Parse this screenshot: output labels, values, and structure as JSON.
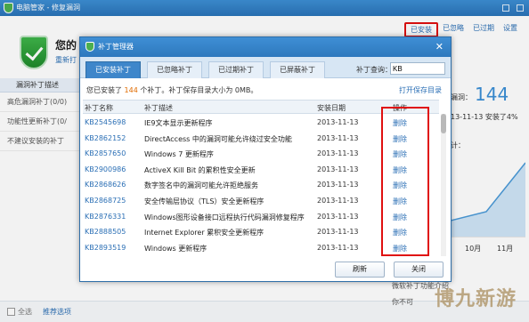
{
  "main_window": {
    "title": "电脑管家 - 修复漏洞",
    "status_title": "您的",
    "status_sub": "重新打",
    "top_links": [
      "已安装",
      "已忽略",
      "已过期",
      "设置"
    ],
    "side_tab": "漏洞补丁描述",
    "side_items": [
      "高危漏洞补丁(0/0)",
      "功能性更新补丁(0/",
      "不建议安装的补丁"
    ],
    "right_label": "漏洞：",
    "right_count": "144",
    "right_date": "13-11-13 安装了4%",
    "right_stat": "计：",
    "axis_labels": [
      "10月",
      "11月"
    ],
    "select_all": "全选",
    "recommend": "推荐选项",
    "tip_1": "微软补丁功能介绍",
    "tip_2": "你不可",
    "watermark": "博九新游"
  },
  "dialog": {
    "title": "补丁管理器",
    "close_glyph": "✕",
    "tabs": [
      "已安装补丁",
      "已忽略补丁",
      "已过期补丁",
      "已屏蔽补丁"
    ],
    "search_label": "补丁查询：",
    "search_value": "KB",
    "info_prefix": "您已安装了 ",
    "info_count": "144",
    "info_suffix": " 个补丁。补丁保存目录大小为 0MB。",
    "open_dir": "打开保存目录",
    "headers": [
      "补丁名称",
      "补丁描述",
      "安装日期",
      "操作"
    ],
    "rows": [
      {
        "kb": "KB2545698",
        "desc": "IE9文本显示更新程序",
        "date": "2013-11-13",
        "action": "删除"
      },
      {
        "kb": "KB2862152",
        "desc": "DirectAccess 中的漏洞可能允许绕过安全功能",
        "date": "2013-11-13",
        "action": "删除"
      },
      {
        "kb": "KB2857650",
        "desc": "Windows 7 更新程序",
        "date": "2013-11-13",
        "action": "删除"
      },
      {
        "kb": "KB2900986",
        "desc": "ActiveX Kill Bit 的累积性安全更新",
        "date": "2013-11-13",
        "action": "删除"
      },
      {
        "kb": "KB2868626",
        "desc": "数字签名中的漏洞可能允许拒绝服务",
        "date": "2013-11-13",
        "action": "删除"
      },
      {
        "kb": "KB2868725",
        "desc": "安全传输层协议（TLS）安全更新程序",
        "date": "2013-11-13",
        "action": "删除"
      },
      {
        "kb": "KB2876331",
        "desc": "Windows图形设备接口远程执行代码漏洞修复程序",
        "date": "2013-11-13",
        "action": "删除"
      },
      {
        "kb": "KB2888505",
        "desc": "Internet Explorer 累积安全更新程序",
        "date": "2013-11-13",
        "action": "删除"
      },
      {
        "kb": "KB2893519",
        "desc": "Windows 更新程序",
        "date": "2013-11-13",
        "action": "删除"
      }
    ],
    "refresh_label": "刷新",
    "close_label": "关闭"
  },
  "colors": {
    "accent": "#3e86ca",
    "highlight_box": "#e01010",
    "link": "#2b6fb5",
    "count": "#e06b00"
  }
}
